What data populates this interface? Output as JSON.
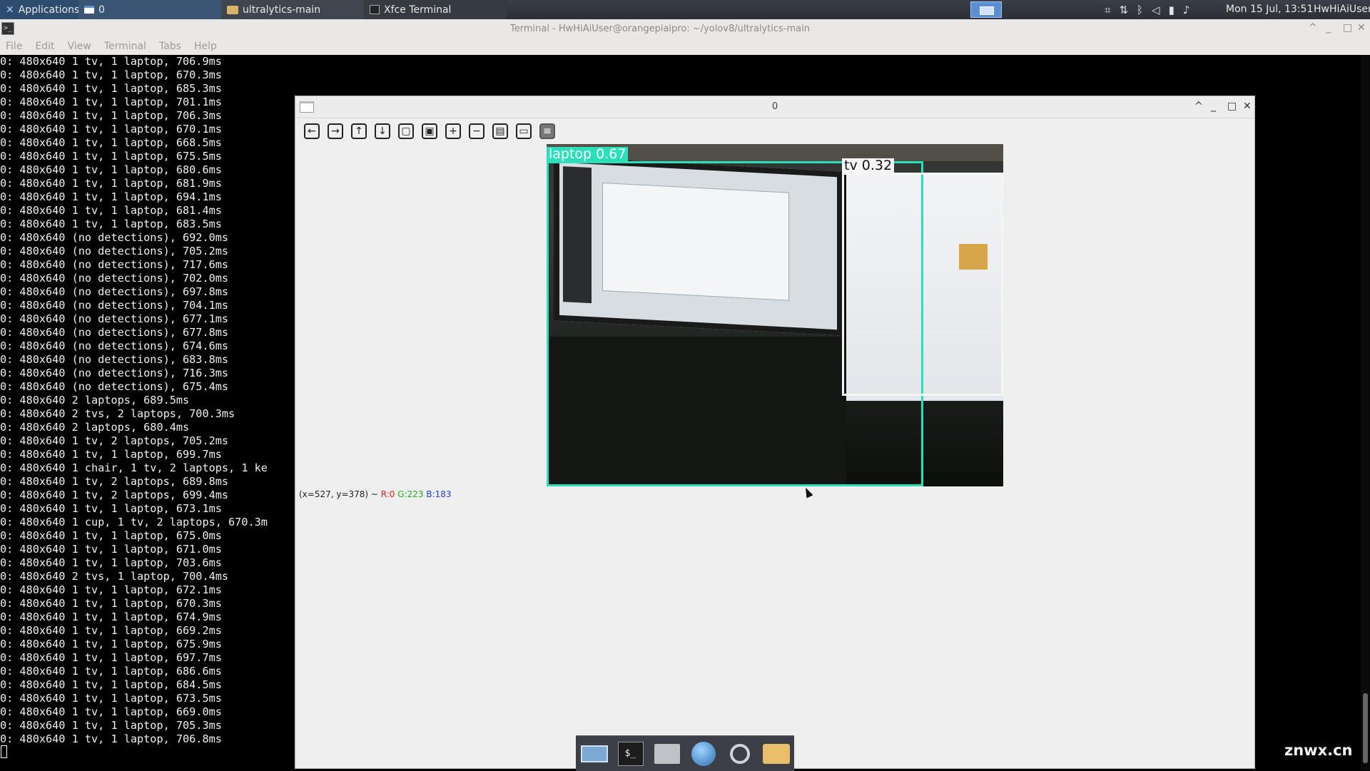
{
  "top_panel": {
    "apps_label": "Applications",
    "tasks": [
      {
        "label": "0"
      },
      {
        "label": "ultralytics-main"
      },
      {
        "label": "Xfce Terminal"
      }
    ],
    "clock": "Mon 15 Jul, 13:51",
    "user": "HwHiAiUser",
    "tray_icons": [
      "keyboard-layout-icon",
      "network-icon",
      "bluetooth-icon",
      "volume-icon",
      "battery-icon",
      "notification-bell-icon"
    ]
  },
  "terminal": {
    "title": "Terminal - HwHiAiUser@orangepiaipro: ~/yolov8/ultralytics-main",
    "menu": [
      "File",
      "Edit",
      "View",
      "Terminal",
      "Tabs",
      "Help"
    ],
    "lines": [
      "0: 480x640 1 tv, 1 laptop, 706.9ms",
      "0: 480x640 1 tv, 1 laptop, 670.3ms",
      "0: 480x640 1 tv, 1 laptop, 685.3ms",
      "0: 480x640 1 tv, 1 laptop, 701.1ms",
      "0: 480x640 1 tv, 1 laptop, 706.3ms",
      "0: 480x640 1 tv, 1 laptop, 670.1ms",
      "0: 480x640 1 tv, 1 laptop, 668.5ms",
      "0: 480x640 1 tv, 1 laptop, 675.5ms",
      "0: 480x640 1 tv, 1 laptop, 680.6ms",
      "0: 480x640 1 tv, 1 laptop, 681.9ms",
      "0: 480x640 1 tv, 1 laptop, 694.1ms",
      "0: 480x640 1 tv, 1 laptop, 681.4ms",
      "0: 480x640 1 tv, 1 laptop, 683.5ms",
      "0: 480x640 (no detections), 692.0ms",
      "0: 480x640 (no detections), 705.2ms",
      "0: 480x640 (no detections), 717.6ms",
      "0: 480x640 (no detections), 702.0ms",
      "0: 480x640 (no detections), 697.8ms",
      "0: 480x640 (no detections), 704.1ms",
      "0: 480x640 (no detections), 677.1ms",
      "0: 480x640 (no detections), 677.8ms",
      "0: 480x640 (no detections), 674.6ms",
      "0: 480x640 (no detections), 683.8ms",
      "0: 480x640 (no detections), 716.3ms",
      "0: 480x640 (no detections), 675.4ms",
      "0: 480x640 2 laptops, 689.5ms",
      "0: 480x640 2 tvs, 2 laptops, 700.3ms",
      "0: 480x640 2 laptops, 680.4ms",
      "0: 480x640 1 tv, 2 laptops, 705.2ms",
      "0: 480x640 1 tv, 1 laptop, 699.7ms",
      "0: 480x640 1 chair, 1 tv, 2 laptops, 1 ke",
      "0: 480x640 1 tv, 2 laptops, 689.8ms",
      "0: 480x640 1 tv, 2 laptops, 699.4ms",
      "0: 480x640 1 tv, 1 laptop, 673.1ms",
      "0: 480x640 1 cup, 1 tv, 2 laptops, 670.3m",
      "0: 480x640 1 tv, 1 laptop, 675.0ms",
      "0: 480x640 1 tv, 1 laptop, 671.0ms",
      "0: 480x640 1 tv, 1 laptop, 703.6ms",
      "0: 480x640 2 tvs, 1 laptop, 700.4ms",
      "0: 480x640 1 tv, 1 laptop, 672.1ms",
      "0: 480x640 1 tv, 1 laptop, 670.3ms",
      "0: 480x640 1 tv, 1 laptop, 674.9ms",
      "0: 480x640 1 tv, 1 laptop, 669.2ms",
      "0: 480x640 1 tv, 1 laptop, 675.9ms",
      "0: 480x640 1 tv, 1 laptop, 697.7ms",
      "0: 480x640 1 tv, 1 laptop, 686.6ms",
      "0: 480x640 1 tv, 1 laptop, 684.5ms",
      "0: 480x640 1 tv, 1 laptop, 673.5ms",
      "0: 480x640 1 tv, 1 laptop, 669.0ms",
      "0: 480x640 1 tv, 1 laptop, 705.3ms",
      "0: 480x640 1 tv, 1 laptop, 706.8ms"
    ]
  },
  "image_window": {
    "title": "0",
    "toolbar": [
      {
        "name": "pan-left-icon",
        "glyph": "←"
      },
      {
        "name": "pan-right-icon",
        "glyph": "→"
      },
      {
        "name": "pan-up-icon",
        "glyph": "↑"
      },
      {
        "name": "pan-down-icon",
        "glyph": "↓"
      },
      {
        "name": "zoom-fit-icon",
        "glyph": "▢"
      },
      {
        "name": "zoom-original-icon",
        "glyph": "▣"
      },
      {
        "name": "zoom-in-icon",
        "glyph": "+"
      },
      {
        "name": "zoom-out-icon",
        "glyph": "−"
      },
      {
        "name": "save-icon",
        "glyph": "▤"
      },
      {
        "name": "copy-icon",
        "glyph": "▭"
      },
      {
        "name": "properties-icon",
        "glyph": "≡"
      }
    ],
    "detections": [
      {
        "label": "laptop 0.67",
        "color": "#2bdfba"
      },
      {
        "label": "tv 0.32",
        "color": "#f5f5f5"
      }
    ],
    "status": {
      "coords": "(x=527, y=378) ~ ",
      "r": "R:0",
      "g": "G:223",
      "b": "B:183"
    }
  },
  "dock": [
    "desktop-icon",
    "terminal-icon",
    "home-folder-icon",
    "web-browser-icon",
    "app-finder-icon",
    "file-manager-icon"
  ],
  "dock_terminal_glyph": "$_",
  "watermark": "znwx.cn",
  "colors": {
    "accent": "#5a8fd6",
    "laptop_box": "#2bdfba",
    "tv_box": "#f5f5f5"
  }
}
